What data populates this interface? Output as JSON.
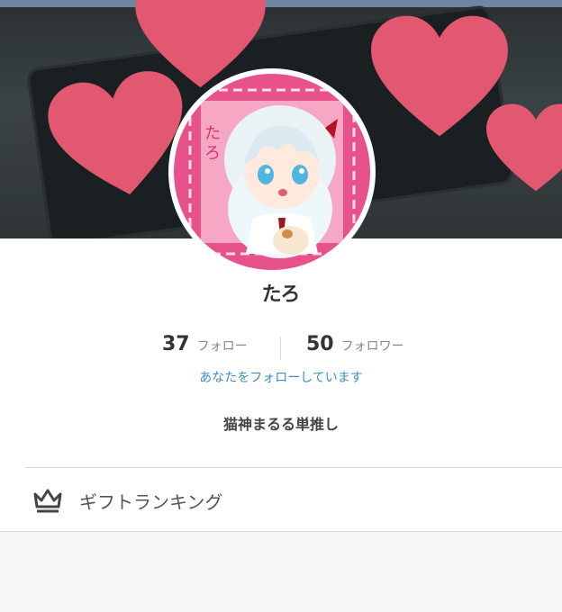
{
  "profile": {
    "name": "たろ",
    "avatar_text": "たろ",
    "following_count": "37",
    "following_label": "フォロー",
    "followers_count": "50",
    "followers_label": "フォロワー",
    "follows_you_text": "あなたをフォローしています",
    "bio": "猫神まるる単推し"
  },
  "menu": {
    "gift_ranking_label": "ギフトランキング",
    "gift_ranking_icon": "crown-icon"
  },
  "colors": {
    "accent_link": "#3d8fc0",
    "heart": "#e25870",
    "avatar_bg": "#e7528a"
  }
}
